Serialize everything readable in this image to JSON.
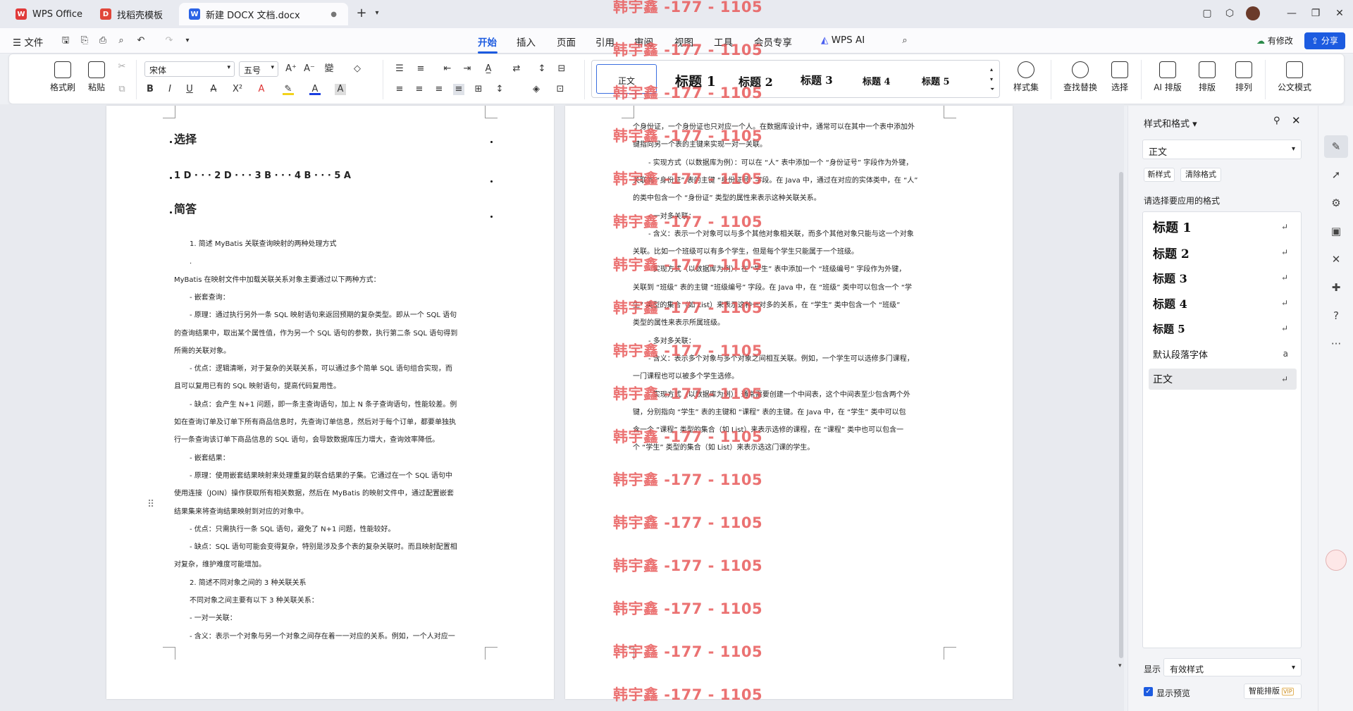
{
  "tabs": [
    {
      "label": "WPS Office"
    },
    {
      "label": "找稻壳模板"
    },
    {
      "label": "新建 DOCX 文档.docx"
    }
  ],
  "menubar": {
    "file": "文件",
    "items": [
      "开始",
      "插入",
      "页面",
      "引用",
      "审阅",
      "视图",
      "工具",
      "会员专享"
    ],
    "wps_ai": "WPS AI",
    "youxiugai": "有修改",
    "share": "分享"
  },
  "ribbon": {
    "format_painter": "格式刷",
    "paste": "粘贴",
    "font_name": "宋体",
    "font_size": "五号",
    "styles": [
      "正文",
      "标题  1",
      "标题  2",
      "标题  3",
      "标题 4",
      "标题  5"
    ],
    "style_set": "样式集",
    "find_replace": "查找替换",
    "select": "选择",
    "ai_layout": "AI 排版",
    "layout": "排版",
    "arrange": "排列",
    "official_doc": "公文模式"
  },
  "page1": {
    "h_select": "选择",
    "answers": "1 D · · · 2 D · · · 3 B · · · 4 B · · · 5 A",
    "h_short": "简答",
    "lines": [
      "1. 简述 MyBatis 关联查询映射的两种处理方式",
      ".",
      "MyBatis 在映射文件中加载关联关系对象主要通过以下两种方式：",
      "- 嵌套查询：",
      "- 原理：通过执行另外一条 SQL 映射语句来返回预期的复杂类型。即从一个 SQL 语句",
      "的查询结果中，取出某个属性值，作为另一个 SQL 语句的参数，执行第二条 SQL 语句得到",
      "所需的关联对象。",
      "- 优点：逻辑清晰，对于复杂的关联关系，可以通过多个简单 SQL 语句组合实现，而",
      "且可以复用已有的 SQL 映射语句，提高代码复用性。",
      "- 缺点：会产生 N+1 问题，即一条主查询语句，加上 N 条子查询语句，性能较差。例",
      "如在查询订单及订单下所有商品信息时，先查询订单信息，然后对于每个订单，都要单独执",
      "行一条查询该订单下商品信息的 SQL 语句，会导致数据库压力增大，查询效率降低。",
      "- 嵌套结果：",
      "- 原理：使用嵌套结果映射来处理重复的联合结果的子集。它通过在一个 SQL 语句中",
      "使用连接（JOIN）操作获取所有相关数据，然后在 MyBatis 的映射文件中，通过配置嵌套",
      "结果集来将查询结果映射到对应的对象中。",
      "- 优点：只需执行一条 SQL 语句，避免了 N+1 问题，性能较好。",
      "- 缺点：SQL 语句可能会变得复杂，特别是涉及多个表的复杂关联时。而且映射配置相",
      "对复杂，维护难度可能增加。",
      "2. 简述不同对象之间的 3 种关联关系",
      "不同对象之间主要有以下 3 种关联关系：",
      "- 一对一关联：",
      "- 含义：表示一个对象与另一个对象之间存在着一一对应的关系。例如，一个人对应一"
    ]
  },
  "page2": {
    "lines": [
      "个身份证，一个身份证也只对应一个人。在数据库设计中，通常可以在其中一个表中添加外",
      "键指向另一个表的主键来实现一对一关联。",
      "- 实现方式（以数据库为例）：可以在 “人” 表中添加一个 “身份证号” 字段作为外键，",
      "关联到 “身份证” 表的主键 “身份证号” 字段。在 Java 中，通过在对应的实体类中，在 “人”",
      "的类中包含一个 “身份证” 类型的属性来表示这种关联关系。",
      "- 一对多关联：",
      "- 含义：表示一个对象可以与多个其他对象相关联，而多个其他对象只能与这一个对象",
      "关联。比如一个班级可以有多个学生，但是每个学生只能属于一个班级。",
      "- 实现方式（以数据库为例）：在 “学生” 表中添加一个 “班级编号” 字段作为外键，",
      "关联到 “班级” 表的主键 “班级编号” 字段。在 Java 中，在 “班级” 类中可以包含一个 “学",
      "生” 类型的集合（如 List）来表示这种一对多的关系，在 “学生” 类中包含一个 “班级”",
      "类型的属性来表示所属班级。",
      "- 多对多关联：",
      "- 含义：表示多个对象与多个对象之间相互关联。例如，一个学生可以选修多门课程，",
      "一门课程也可以被多个学生选修。",
      "- 实现方式（以数据库为例）：通常需要创建一个中间表，这个中间表至少包含两个外",
      "键，分别指向 “学生” 表的主键和 “课程” 表的主键。在 Java 中，在 “学生” 类中可以包",
      "含一个 “课程” 类型的集合（如 List）来表示选修的课程，在 “课程” 类中也可以包含一",
      "个 “学生” 类型的集合（如 List）来表示选这门课的学生。"
    ]
  },
  "watermark": "韩宇鑫 -177 - 1105",
  "panel": {
    "title": "样式和格式",
    "current_style": "正文",
    "new_style": "新样式",
    "clear_format": "清除格式",
    "prompt": "请选择要应用的格式",
    "styles": [
      "标题  1",
      "标题  2",
      "标题  3",
      "标题 4",
      "标题 5",
      "默认段落字体",
      "正文"
    ],
    "show_label": "显示",
    "show_value": "有效样式",
    "preview": "显示预览",
    "smart_layout": "智能排版"
  },
  "colors": {
    "accent": "#1c5be0",
    "watermark": "#e85a5a",
    "wps_red": "#e03a3a"
  }
}
